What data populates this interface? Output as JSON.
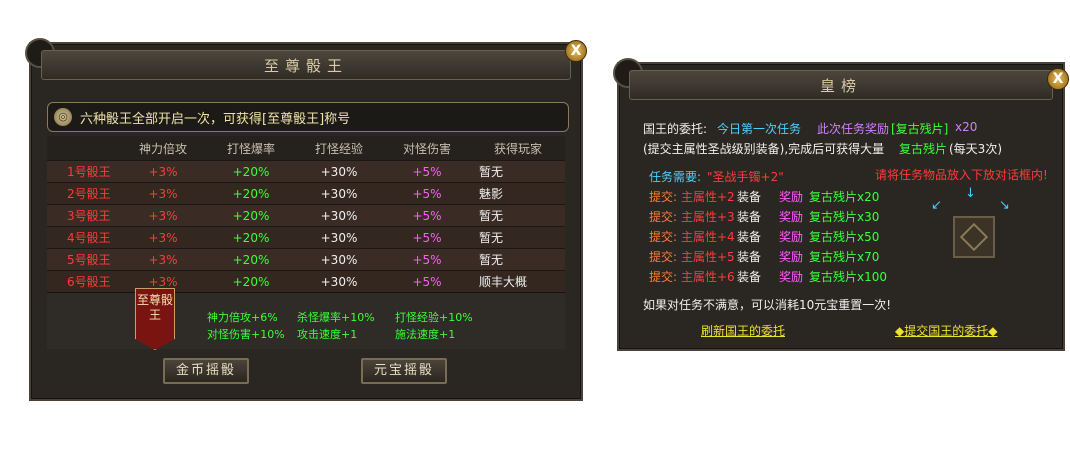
{
  "left_panel": {
    "title": "至尊骰王",
    "close": "X",
    "notice": "六种骰王全部开启一次，可获得[至尊骰王]称号",
    "columns": [
      "",
      "神力倍攻",
      "打怪爆率",
      "打怪经验",
      "对怪伤害",
      "获得玩家"
    ],
    "rows": [
      {
        "name": "1号骰王",
        "a": "+3%",
        "b": "+20%",
        "c": "+30%",
        "d": "+5%",
        "player": "暂无"
      },
      {
        "name": "2号骰王",
        "a": "+3%",
        "b": "+20%",
        "c": "+30%",
        "d": "+5%",
        "player": "魅影"
      },
      {
        "name": "3号骰王",
        "a": "+3%",
        "b": "+20%",
        "c": "+30%",
        "d": "+5%",
        "player": "暂无"
      },
      {
        "name": "4号骰王",
        "a": "+3%",
        "b": "+20%",
        "c": "+30%",
        "d": "+5%",
        "player": "暂无"
      },
      {
        "name": "5号骰王",
        "a": "+3%",
        "b": "+20%",
        "c": "+30%",
        "d": "+5%",
        "player": "暂无"
      },
      {
        "name": "6号骰王",
        "a": "+3%",
        "b": "+20%",
        "c": "+30%",
        "d": "+5%",
        "player": "顺丰大概"
      }
    ],
    "banner": "至尊骰王",
    "bonuses": [
      "神力倍攻+6%",
      "杀怪爆率+10%",
      "打怪经验+10%",
      "对怪伤害+10%",
      "攻击速度+1",
      "施法速度+1"
    ],
    "btn_gold": "金币摇骰",
    "btn_yuanbao": "元宝摇骰"
  },
  "right_panel": {
    "title": "皇榜",
    "close": "X",
    "line1_a": "国王的委托:",
    "line1_b": "今日第一次任务",
    "line1_c": "此次任务奖励",
    "line1_d": "[复古残片]",
    "line1_e": "x20",
    "line2_a": "(提交主属性圣战级别装备),完成后可获得大量",
    "line2_b": "复古残片",
    "line2_c": "(每天3次)",
    "req_label": "任务需要:",
    "req_value": "\"圣战手镯+2\"",
    "hint": "请将任务物品放入下放对话框内!",
    "tasks": [
      {
        "submit": "提交:",
        "attr": "主属性+2",
        "equip": "装备",
        "reward": "奖励",
        "item": "复古残片x20"
      },
      {
        "submit": "提交:",
        "attr": "主属性+3",
        "equip": "装备",
        "reward": "奖励",
        "item": "复古残片x30"
      },
      {
        "submit": "提交:",
        "attr": "主属性+4",
        "equip": "装备",
        "reward": "奖励",
        "item": "复古残片x50"
      },
      {
        "submit": "提交:",
        "attr": "主属性+5",
        "equip": "装备",
        "reward": "奖励",
        "item": "复古残片x70"
      },
      {
        "submit": "提交:",
        "attr": "主属性+6",
        "equip": "装备",
        "reward": "奖励",
        "item": "复古残片x100"
      }
    ],
    "reset_note": "如果对任务不满意，可以消耗10元宝重置一次!",
    "link_refresh": "刷新国王的委托",
    "link_submit": "◆提交国王的委托◆"
  }
}
